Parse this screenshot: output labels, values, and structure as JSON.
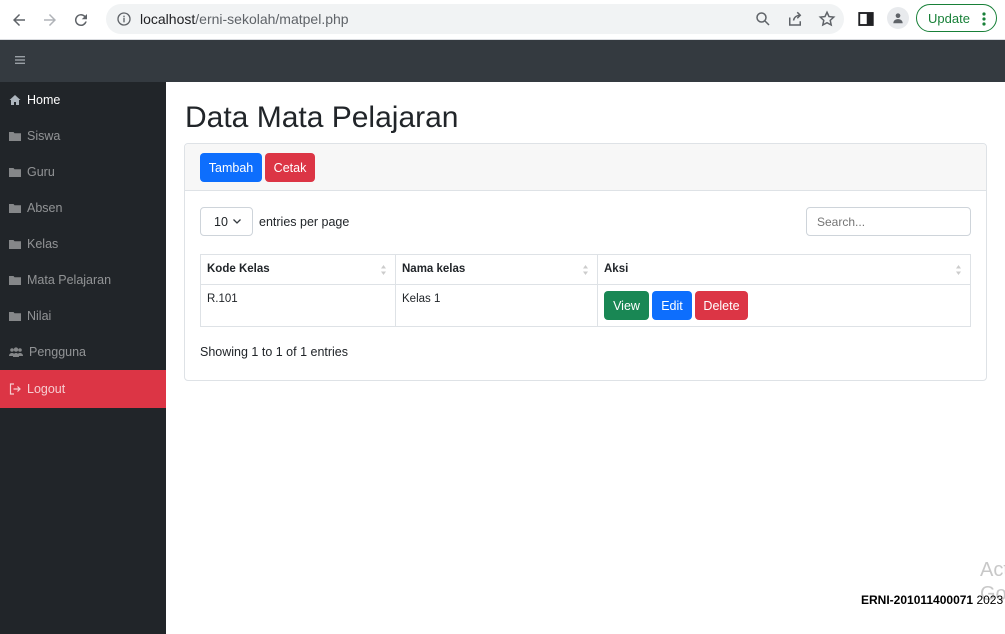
{
  "browser": {
    "url_host": "localhost",
    "url_path": "/erni-sekolah/matpel.php",
    "update_label": "Update"
  },
  "sidebar": {
    "items": [
      {
        "label": "Home",
        "icon": "home-icon"
      },
      {
        "label": "Siswa",
        "icon": "folder-icon"
      },
      {
        "label": "Guru",
        "icon": "folder-icon"
      },
      {
        "label": "Absen",
        "icon": "folder-icon"
      },
      {
        "label": "Kelas",
        "icon": "folder-icon"
      },
      {
        "label": "Mata Pelajaran",
        "icon": "folder-icon"
      },
      {
        "label": "Nilai",
        "icon": "folder-icon"
      },
      {
        "label": "Pengguna",
        "icon": "users-icon"
      }
    ],
    "logout_label": "Logout"
  },
  "main": {
    "title": "Data Mata Pelajaran",
    "add_label": "Tambah",
    "print_label": "Cetak",
    "entries_value": "10",
    "entries_label": "entries per page",
    "search_placeholder": "Search...",
    "table": {
      "headers": [
        "Kode Kelas",
        "Nama kelas",
        "Aksi"
      ],
      "rows": [
        {
          "kode": "R.101",
          "nama": "Kelas 1",
          "view": "View",
          "edit": "Edit",
          "delete": "Delete"
        }
      ]
    },
    "info": "Showing 1 to 1 of 1 entries"
  },
  "footer": {
    "signature": "ERNI-201011400071",
    "year": "2023",
    "watermark": "Act\nGo"
  },
  "colors": {
    "primary": "#0d6efd",
    "danger": "#dc3545",
    "success": "#198754",
    "sidebar_bg": "#212529",
    "topbar_bg": "#343a40"
  }
}
